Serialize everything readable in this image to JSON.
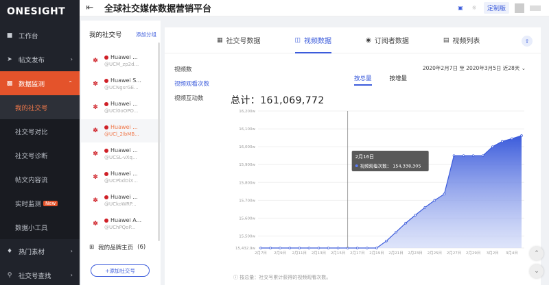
{
  "brand": "ONESIGHT",
  "nav": {
    "items": [
      {
        "label": "工作台",
        "icon": "dashboard-icon"
      },
      {
        "label": "帖文发布",
        "icon": "send-icon"
      },
      {
        "label": "数据监测",
        "icon": "chart-icon"
      }
    ],
    "sub_items": [
      {
        "label": "我的社交号"
      },
      {
        "label": "社交号对比"
      },
      {
        "label": "社交号诊断"
      },
      {
        "label": "帖文内容流"
      },
      {
        "label": "实时监测",
        "badge": "New"
      },
      {
        "label": "数据小工具"
      }
    ],
    "bottom_items": [
      {
        "label": "热门素材",
        "icon": "fire-icon"
      },
      {
        "label": "社交号查找",
        "icon": "search-icon"
      }
    ]
  },
  "header": {
    "title": "全球社交媒体数据营销平台",
    "custom_label": "定制版"
  },
  "accounts": {
    "title": "我的社交号",
    "add_group": "添加分组",
    "list": [
      {
        "name": "Huawei ...",
        "handle": "@UCM_zp2d..."
      },
      {
        "name": "Huawei S...",
        "handle": "@UCNgsrGE..."
      },
      {
        "name": "Huawei ...",
        "handle": "@UCl0oOPO..."
      },
      {
        "name": "Huawei ...",
        "handle": "@UCl_2lbMB..."
      },
      {
        "name": "Huawei ...",
        "handle": "@UCSL-vXq..."
      },
      {
        "name": "Huawei ...",
        "handle": "@UCPbdDiX..."
      },
      {
        "name": "Huawei ...",
        "handle": "@UCkoWRP..."
      },
      {
        "name": "Huawei A...",
        "handle": "@UChPQoP..."
      }
    ],
    "selected_index": 3,
    "brand_home": "我的品牌主页",
    "brand_count": "(6)",
    "add_button": "+添加社交号"
  },
  "tabs": [
    {
      "label": "社交号数据",
      "icon": "grid-icon"
    },
    {
      "label": "视频数据",
      "icon": "video-icon"
    },
    {
      "label": "订阅者数据",
      "icon": "subscriber-icon"
    },
    {
      "label": "视频列表",
      "icon": "list-icon"
    }
  ],
  "active_tab": 1,
  "metrics": [
    "视频数",
    "视频观看次数",
    "视频互动数"
  ],
  "active_metric": 1,
  "date_range": "2020年2月7日 至 2020年3月5日 近28天",
  "toggle": [
    "按总量",
    "按增量"
  ],
  "total_label": "总计：",
  "total_value": "161,069,772",
  "tooltip": {
    "date": "2月16日",
    "label": "视频观看次数：",
    "value": "154,338,305"
  },
  "footnote": "按总量：社交号累计获得的视频观看次数。",
  "chart_data": {
    "type": "area",
    "x": [
      "2月7日",
      "2月8日",
      "2月9日",
      "2月10日",
      "2月11日",
      "2月12日",
      "2月13日",
      "2月14日",
      "2月15日",
      "2月16日",
      "2月17日",
      "2月18日",
      "2月19日",
      "2月20日",
      "2月21日",
      "2月22日",
      "2月23日",
      "2月24日",
      "2月25日",
      "2月26日",
      "2月27日",
      "2月28日",
      "2月29日",
      "3月1日",
      "3月2日",
      "3月3日",
      "3月4日",
      "3月5日"
    ],
    "x_ticks": [
      "2月7日",
      "2月9日",
      "2月11日",
      "2月13日",
      "2月15日",
      "2月17日",
      "2月19日",
      "2月21日",
      "2月23日",
      "2月25日",
      "2月27日",
      "2月29日",
      "3月2日",
      "3月4日"
    ],
    "values": [
      15432.9,
      15432.9,
      15432.9,
      15432.9,
      15432.9,
      15432.9,
      15432.9,
      15432.9,
      15432.9,
      15432.9,
      15432.9,
      15432.9,
      15432.9,
      15472,
      15522,
      15572,
      15617,
      15660,
      15700,
      15735,
      15950,
      15950,
      15950,
      15950,
      16000,
      16030,
      16045,
      16062
    ],
    "y_ticks": [
      15432.9,
      15500,
      15600,
      15700,
      15800,
      15900,
      16000,
      16100,
      16200
    ],
    "y_tick_labels": [
      "15,432.9w",
      "15,500w",
      "15,600w",
      "15,700w",
      "15,800w",
      "15,900w",
      "16,000w",
      "16,100w",
      "16,200w"
    ],
    "ylim": [
      15432.9,
      16200
    ],
    "series_color": "#3b5bdb",
    "tooltip_index": 9
  },
  "colors": {
    "accent": "#3b5bdb",
    "brand": "#e4532b",
    "nav_bg": "#20232b"
  }
}
